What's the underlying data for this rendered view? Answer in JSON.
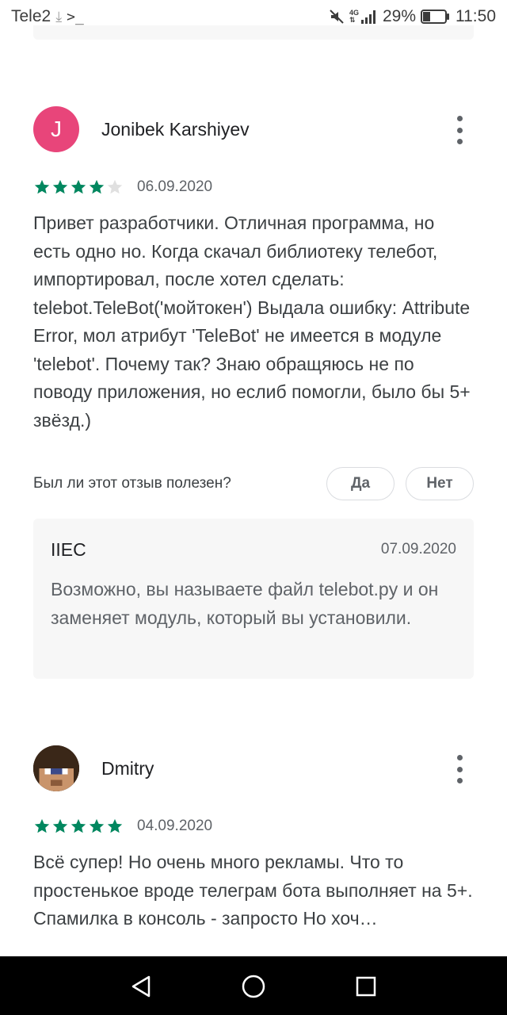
{
  "status_bar": {
    "carrier": "Tele2",
    "download_icon": "download-arrow-icon",
    "terminal_icon": "terminal-prompt-icon",
    "network_type_top": "4G",
    "network_type_bottom": "⇅",
    "battery_percent": "29%",
    "time": "11:50"
  },
  "reviews": [
    {
      "author": "Jonibek Karshiyev",
      "avatar_letter": "J",
      "avatar_color": "#e8457a",
      "rating": 4,
      "max_rating": 5,
      "date": "06.09.2020",
      "text": "Привет разработчики. Отличная программа, но есть одно но. Когда скачал библиотеку телебот, импортировал, после хотел сделать: telebot.TeleBot('мойтокен') Выдала ошибку: Attribute Error, мол атрибут 'TeleBot' не имеется в модуле 'telebot'. Почему так? Знаю обращяюсь не по поводу приложения, но еслиб помогли, было бы 5+ звёзд.)",
      "helpful_question": "Был ли этот отзыв полезен?",
      "helpful_yes": "Да",
      "helpful_no": "Нет",
      "reply": {
        "developer": "IIEC",
        "date": "07.09.2020",
        "text": "Возможно, вы называете файл telebot.py и он заменяет модуль, который вы установили."
      }
    },
    {
      "author": "Dmitry",
      "rating": 5,
      "max_rating": 5,
      "date": "04.09.2020",
      "text": "Всё супер! Но очень много рекламы. Что то простенькое вроде телеграм бота выполняет на 5+. Спамилка в консоль - запросто Но хоч…"
    }
  ],
  "colors": {
    "star_filled": "#01875f",
    "star_empty": "#e0e0e0",
    "accent": "#01875f"
  },
  "nav_bar": {
    "back_icon": "back-triangle-icon",
    "home_icon": "home-circle-icon",
    "recent_icon": "recent-apps-square-icon"
  }
}
